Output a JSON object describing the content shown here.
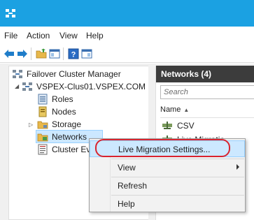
{
  "window": {
    "icon": "failover-cluster-icon"
  },
  "menubar": {
    "items": [
      "File",
      "Action",
      "View",
      "Help"
    ]
  },
  "toolbar": {
    "buttons": [
      "back-arrow-icon",
      "forward-arrow-icon",
      "folder-up-icon",
      "show-hide-tree-icon",
      "help-icon",
      "action-pane-icon"
    ]
  },
  "tree": {
    "root": "Failover Cluster Manager",
    "cluster": "VSPEX-Clus01.VSPEX.COM",
    "items": [
      "Roles",
      "Nodes",
      "Storage",
      "Networks",
      "Cluster Ev"
    ]
  },
  "networks_pane": {
    "title": "Networks (4)",
    "search_placeholder": "Search",
    "column": "Name",
    "rows": [
      "CSV",
      "Live Migratio"
    ]
  },
  "context_menu": {
    "items": [
      "Live Migration Settings...",
      "View",
      "Refresh",
      "Help"
    ]
  },
  "colors": {
    "titlebar": "#1ba1e2",
    "highlight": "#cce8ff",
    "annotation": "#d9232e"
  }
}
